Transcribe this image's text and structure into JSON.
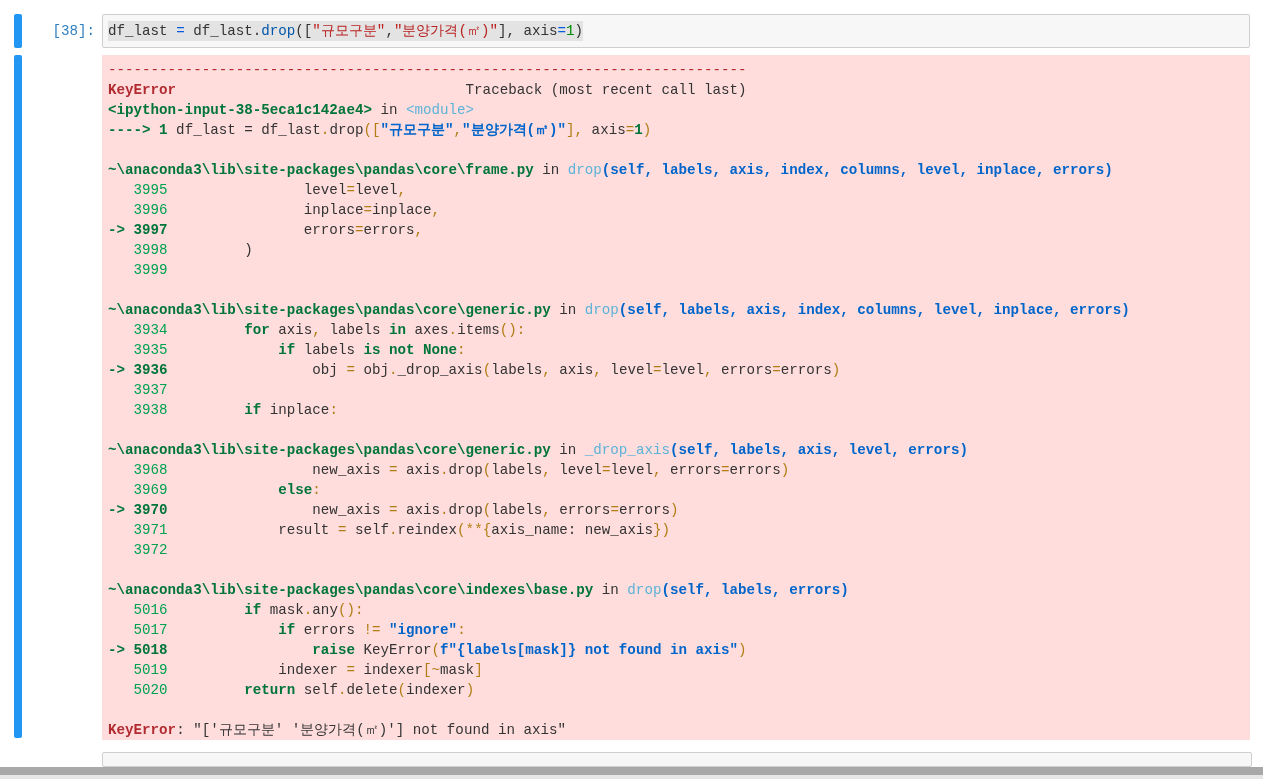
{
  "input_cell": {
    "prompt": "[38]:",
    "code": [
      {
        "text": "df_last ",
        "kind": "name"
      },
      {
        "text": "=",
        "kind": "op_in"
      },
      {
        "text": " df_last.",
        "kind": "name"
      },
      {
        "text": "drop",
        "kind": "attr"
      },
      {
        "text": "([",
        "kind": "name"
      },
      {
        "text": "\"규모구분\"",
        "kind": "str_in"
      },
      {
        "text": ",",
        "kind": "name"
      },
      {
        "text": "\"분양가격(㎡)\"",
        "kind": "str_in"
      },
      {
        "text": "], axis",
        "kind": "name"
      },
      {
        "text": "=",
        "kind": "op_in"
      },
      {
        "text": "1",
        "kind": "num_in"
      },
      {
        "text": ")",
        "kind": "name"
      }
    ]
  },
  "output": {
    "blocks": [
      [
        [
          {
            "text": "---------------------------------------------------------------------------",
            "kind": "rule"
          }
        ],
        [
          {
            "text": "KeyError",
            "kind": "exc"
          },
          {
            "text": "                                  Traceback (most recent call last)",
            "kind": "plain"
          }
        ],
        [
          {
            "text": "<ipython-input-38-5eca1c142ae4>",
            "kind": "loc"
          },
          {
            "text": " in ",
            "kind": "plain"
          },
          {
            "text": "<module>",
            "kind": "func"
          }
        ],
        [
          {
            "text": "----> 1",
            "kind": "curno"
          },
          {
            "text": " df_last = df_last",
            "kind": "plain"
          },
          {
            "text": ".",
            "kind": "op"
          },
          {
            "text": "drop",
            "kind": "plain"
          },
          {
            "text": "([",
            "kind": "op"
          },
          {
            "text": "\"규모구분\"",
            "kind": "str"
          },
          {
            "text": ",",
            "kind": "op"
          },
          {
            "text": "\"분양가격(㎡)\"",
            "kind": "str"
          },
          {
            "text": "],",
            "kind": "op"
          },
          {
            "text": " axis",
            "kind": "plain"
          },
          {
            "text": "=",
            "kind": "op"
          },
          {
            "text": "1",
            "kind": "kw"
          },
          {
            "text": ")",
            "kind": "op"
          }
        ]
      ],
      [
        [
          {
            "text": "~\\anaconda3\\lib\\site-packages\\pandas\\core\\frame.py",
            "kind": "loc"
          },
          {
            "text": " in ",
            "kind": "plain"
          },
          {
            "text": "drop",
            "kind": "func"
          },
          {
            "text": "(self, labels, axis, index, columns, level, inplace, errors)",
            "kind": "args"
          }
        ],
        [
          {
            "text": "   3995",
            "kind": "lineno"
          },
          {
            "text": "                level",
            "kind": "plain"
          },
          {
            "text": "=",
            "kind": "op"
          },
          {
            "text": "level",
            "kind": "plain"
          },
          {
            "text": ",",
            "kind": "op"
          }
        ],
        [
          {
            "text": "   3996",
            "kind": "lineno"
          },
          {
            "text": "                inplace",
            "kind": "plain"
          },
          {
            "text": "=",
            "kind": "op"
          },
          {
            "text": "inplace",
            "kind": "plain"
          },
          {
            "text": ",",
            "kind": "op"
          }
        ],
        [
          {
            "text": "-> 3997",
            "kind": "curno"
          },
          {
            "text": "                errors",
            "kind": "plain"
          },
          {
            "text": "=",
            "kind": "op"
          },
          {
            "text": "errors",
            "kind": "plain"
          },
          {
            "text": ",",
            "kind": "op"
          }
        ],
        [
          {
            "text": "   3998",
            "kind": "lineno"
          },
          {
            "text": "         )",
            "kind": "plain"
          }
        ],
        [
          {
            "text": "   3999",
            "kind": "lineno"
          }
        ]
      ],
      [
        [
          {
            "text": "~\\anaconda3\\lib\\site-packages\\pandas\\core\\generic.py",
            "kind": "loc"
          },
          {
            "text": " in ",
            "kind": "plain"
          },
          {
            "text": "drop",
            "kind": "func"
          },
          {
            "text": "(self, labels, axis, index, columns, level, inplace, errors)",
            "kind": "args"
          }
        ],
        [
          {
            "text": "   3934",
            "kind": "lineno"
          },
          {
            "text": "         for",
            "kind": "kw"
          },
          {
            "text": " axis",
            "kind": "plain"
          },
          {
            "text": ",",
            "kind": "op"
          },
          {
            "text": " labels ",
            "kind": "plain"
          },
          {
            "text": "in",
            "kind": "kw"
          },
          {
            "text": " axes",
            "kind": "plain"
          },
          {
            "text": ".",
            "kind": "op"
          },
          {
            "text": "items",
            "kind": "plain"
          },
          {
            "text": "():",
            "kind": "op"
          }
        ],
        [
          {
            "text": "   3935",
            "kind": "lineno"
          },
          {
            "text": "             if",
            "kind": "kw"
          },
          {
            "text": " labels ",
            "kind": "plain"
          },
          {
            "text": "is not None",
            "kind": "kw"
          },
          {
            "text": ":",
            "kind": "op"
          }
        ],
        [
          {
            "text": "-> 3936",
            "kind": "curno"
          },
          {
            "text": "                 obj ",
            "kind": "plain"
          },
          {
            "text": "=",
            "kind": "op"
          },
          {
            "text": " obj",
            "kind": "plain"
          },
          {
            "text": ".",
            "kind": "op"
          },
          {
            "text": "_drop_axis",
            "kind": "plain"
          },
          {
            "text": "(",
            "kind": "op"
          },
          {
            "text": "labels",
            "kind": "plain"
          },
          {
            "text": ",",
            "kind": "op"
          },
          {
            "text": " axis",
            "kind": "plain"
          },
          {
            "text": ",",
            "kind": "op"
          },
          {
            "text": " level",
            "kind": "plain"
          },
          {
            "text": "=",
            "kind": "op"
          },
          {
            "text": "level",
            "kind": "plain"
          },
          {
            "text": ",",
            "kind": "op"
          },
          {
            "text": " errors",
            "kind": "plain"
          },
          {
            "text": "=",
            "kind": "op"
          },
          {
            "text": "errors",
            "kind": "plain"
          },
          {
            "text": ")",
            "kind": "op"
          }
        ],
        [
          {
            "text": "   3937",
            "kind": "lineno"
          }
        ],
        [
          {
            "text": "   3938",
            "kind": "lineno"
          },
          {
            "text": "         if",
            "kind": "kw"
          },
          {
            "text": " inplace",
            "kind": "plain"
          },
          {
            "text": ":",
            "kind": "op"
          }
        ]
      ],
      [
        [
          {
            "text": "~\\anaconda3\\lib\\site-packages\\pandas\\core\\generic.py",
            "kind": "loc"
          },
          {
            "text": " in ",
            "kind": "plain"
          },
          {
            "text": "_drop_axis",
            "kind": "func"
          },
          {
            "text": "(self, labels, axis, level, errors)",
            "kind": "args"
          }
        ],
        [
          {
            "text": "   3968",
            "kind": "lineno"
          },
          {
            "text": "                 new_axis ",
            "kind": "plain"
          },
          {
            "text": "=",
            "kind": "op"
          },
          {
            "text": " axis",
            "kind": "plain"
          },
          {
            "text": ".",
            "kind": "op"
          },
          {
            "text": "drop",
            "kind": "plain"
          },
          {
            "text": "(",
            "kind": "op"
          },
          {
            "text": "labels",
            "kind": "plain"
          },
          {
            "text": ",",
            "kind": "op"
          },
          {
            "text": " level",
            "kind": "plain"
          },
          {
            "text": "=",
            "kind": "op"
          },
          {
            "text": "level",
            "kind": "plain"
          },
          {
            "text": ",",
            "kind": "op"
          },
          {
            "text": " errors",
            "kind": "plain"
          },
          {
            "text": "=",
            "kind": "op"
          },
          {
            "text": "errors",
            "kind": "plain"
          },
          {
            "text": ")",
            "kind": "op"
          }
        ],
        [
          {
            "text": "   3969",
            "kind": "lineno"
          },
          {
            "text": "             else",
            "kind": "kw"
          },
          {
            "text": ":",
            "kind": "op"
          }
        ],
        [
          {
            "text": "-> 3970",
            "kind": "curno"
          },
          {
            "text": "                 new_axis ",
            "kind": "plain"
          },
          {
            "text": "=",
            "kind": "op"
          },
          {
            "text": " axis",
            "kind": "plain"
          },
          {
            "text": ".",
            "kind": "op"
          },
          {
            "text": "drop",
            "kind": "plain"
          },
          {
            "text": "(",
            "kind": "op"
          },
          {
            "text": "labels",
            "kind": "plain"
          },
          {
            "text": ",",
            "kind": "op"
          },
          {
            "text": " errors",
            "kind": "plain"
          },
          {
            "text": "=",
            "kind": "op"
          },
          {
            "text": "errors",
            "kind": "plain"
          },
          {
            "text": ")",
            "kind": "op"
          }
        ],
        [
          {
            "text": "   3971",
            "kind": "lineno"
          },
          {
            "text": "             result ",
            "kind": "plain"
          },
          {
            "text": "=",
            "kind": "op"
          },
          {
            "text": " self",
            "kind": "plain"
          },
          {
            "text": ".",
            "kind": "op"
          },
          {
            "text": "reindex",
            "kind": "plain"
          },
          {
            "text": "(**{",
            "kind": "op"
          },
          {
            "text": "axis_name: new_axis",
            "kind": "plain"
          },
          {
            "text": "})",
            "kind": "op"
          }
        ],
        [
          {
            "text": "   3972",
            "kind": "lineno"
          }
        ]
      ],
      [
        [
          {
            "text": "~\\anaconda3\\lib\\site-packages\\pandas\\core\\indexes\\base.py",
            "kind": "loc"
          },
          {
            "text": " in ",
            "kind": "plain"
          },
          {
            "text": "drop",
            "kind": "func"
          },
          {
            "text": "(self, labels, errors)",
            "kind": "args"
          }
        ],
        [
          {
            "text": "   5016",
            "kind": "lineno"
          },
          {
            "text": "         if",
            "kind": "kw"
          },
          {
            "text": " mask",
            "kind": "plain"
          },
          {
            "text": ".",
            "kind": "op"
          },
          {
            "text": "any",
            "kind": "plain"
          },
          {
            "text": "():",
            "kind": "op"
          }
        ],
        [
          {
            "text": "   5017",
            "kind": "lineno"
          },
          {
            "text": "             if",
            "kind": "kw"
          },
          {
            "text": " errors ",
            "kind": "plain"
          },
          {
            "text": "!= ",
            "kind": "op"
          },
          {
            "text": "\"ignore\"",
            "kind": "str"
          },
          {
            "text": ":",
            "kind": "op"
          }
        ],
        [
          {
            "text": "-> 5018",
            "kind": "curno"
          },
          {
            "text": "                 raise",
            "kind": "kw"
          },
          {
            "text": " KeyError",
            "kind": "plain"
          },
          {
            "text": "(",
            "kind": "op"
          },
          {
            "text": "f\"{labels[mask]} not found in axis\"",
            "kind": "str"
          },
          {
            "text": ")",
            "kind": "op"
          }
        ],
        [
          {
            "text": "   5019",
            "kind": "lineno"
          },
          {
            "text": "             indexer ",
            "kind": "plain"
          },
          {
            "text": "=",
            "kind": "op"
          },
          {
            "text": " indexer",
            "kind": "plain"
          },
          {
            "text": "[~",
            "kind": "op"
          },
          {
            "text": "mask",
            "kind": "plain"
          },
          {
            "text": "]",
            "kind": "op"
          }
        ],
        [
          {
            "text": "   5020",
            "kind": "lineno"
          },
          {
            "text": "         return",
            "kind": "kw"
          },
          {
            "text": " self",
            "kind": "plain"
          },
          {
            "text": ".",
            "kind": "op"
          },
          {
            "text": "delete",
            "kind": "plain"
          },
          {
            "text": "(",
            "kind": "op"
          },
          {
            "text": "indexer",
            "kind": "plain"
          },
          {
            "text": ")",
            "kind": "op"
          }
        ]
      ],
      [
        [
          {
            "text": "KeyError",
            "kind": "exc"
          },
          {
            "text": ": \"['규모구분' '분양가격(㎡)'] not found in axis\"",
            "kind": "plain"
          }
        ]
      ]
    ]
  }
}
